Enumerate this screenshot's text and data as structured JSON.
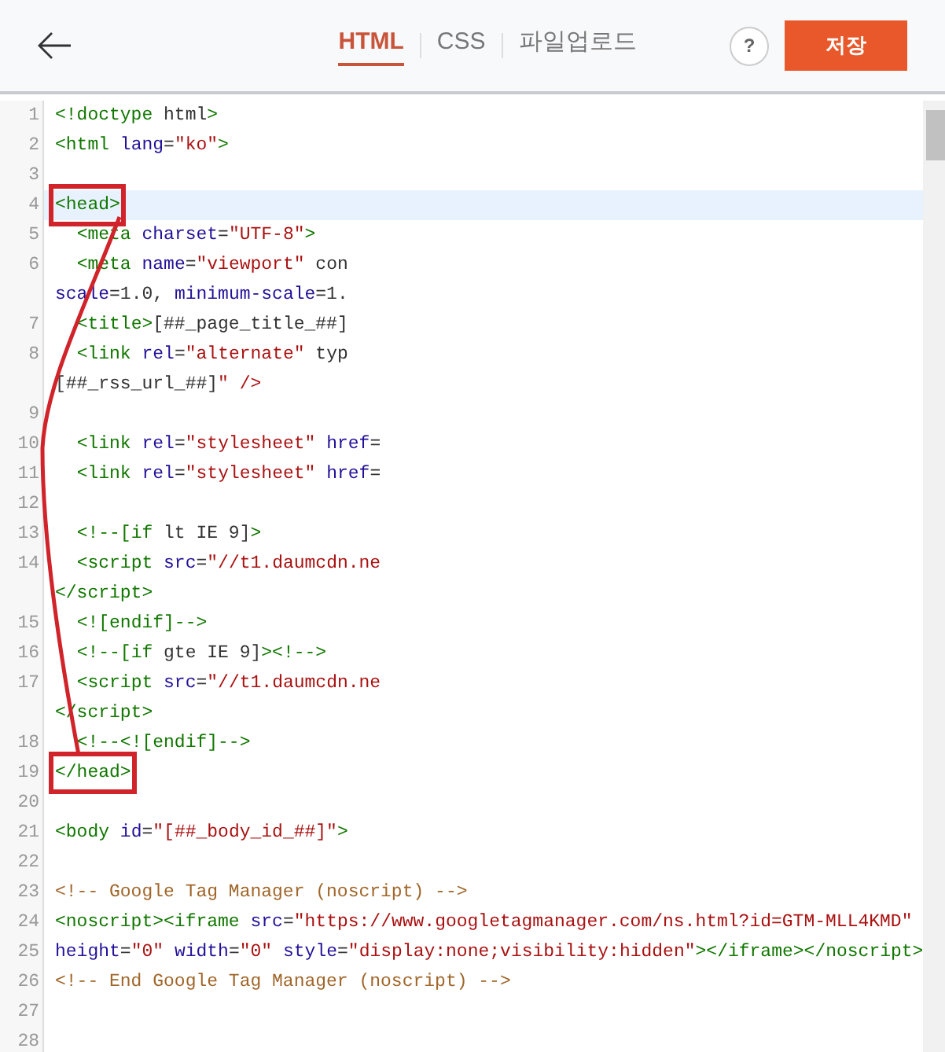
{
  "tabs": [
    {
      "label": "HTML",
      "selected": true
    },
    {
      "label": "CSS",
      "selected": false
    },
    {
      "label": "파일업로드",
      "selected": false
    }
  ],
  "help": {
    "label": "?"
  },
  "save_button": {
    "label": "저장"
  },
  "editor": {
    "lines": [
      {
        "number": "1",
        "text": "<!doctype html>",
        "active": false,
        "marked": false
      },
      {
        "number": "2",
        "text": "<html lang=\"ko\">",
        "active": false,
        "marked": false
      },
      {
        "number": "3",
        "active": false,
        "marked": false
      },
      {
        "number": "4",
        "text": "<head>",
        "active": true,
        "marked": true
      },
      {
        "number": "5",
        "text": "  <meta charset=\"UTF-8\">",
        "active": false,
        "marked": false
      },
      {
        "number": "6",
        "text": "  <meta name=\"viewport\" con",
        "active": false,
        "marked": false,
        "continuation": "scale=1.0, minimum-scale=1."
      },
      {
        "number": "7",
        "text": "  <title>[##_page_title_##]",
        "active": false,
        "marked": false
      },
      {
        "number": "8",
        "text": "  <link rel=\"alternate\" typ",
        "active": false,
        "marked": false,
        "continuation": "[##_rss_url_##]\" />"
      },
      {
        "number": "9",
        "active": false,
        "marked": false
      },
      {
        "number": "10",
        "text": "  <link rel=\"stylesheet\" href=",
        "active": false,
        "marked": false
      },
      {
        "number": "11",
        "text": "  <link rel=\"stylesheet\" href=",
        "active": false,
        "marked": false
      },
      {
        "number": "12",
        "active": false,
        "marked": false
      },
      {
        "number": "13",
        "text": "  <!--[if lt IE 9]>",
        "active": false,
        "marked": false
      },
      {
        "number": "14",
        "text": "  <script src=\"//t1.daumcdn.ne",
        "active": false,
        "marked": false,
        "continuation": "</script>"
      },
      {
        "number": "15",
        "text": "  <![endif]-->",
        "active": false,
        "marked": false
      },
      {
        "number": "16",
        "text": "  <!--[if gte IE 9]><!-->",
        "active": false,
        "marked": false
      },
      {
        "number": "17",
        "text": "  <script src=\"//t1.daumcdn.ne",
        "active": false,
        "marked": false,
        "continuation": "</script>"
      },
      {
        "number": "18",
        "text": "  <!--<![endif]-->",
        "active": false,
        "marked": false
      },
      {
        "number": "19",
        "text": "</head>",
        "active": false,
        "marked": true
      },
      {
        "number": "20",
        "active": false,
        "marked": false
      },
      {
        "number": "21",
        "text": "<body id=\"[##_body_id_##]\">",
        "active": false,
        "marked": false
      },
      {
        "number": "22",
        "active": false,
        "marked": false
      },
      {
        "number": "23",
        "text": "<!-- Google Tag Manager (noscript) -->",
        "active": false,
        "marked": false
      },
      {
        "number": "24",
        "text": "<noscript><iframe src=\"https://www.googletagmanager.com/ns.html?id=GTM-MLL4KMD\"",
        "active": false,
        "marked": false
      },
      {
        "number": "25",
        "text": "height=\"0\" width=\"0\" style=\"display:none;visibility:hidden\"></iframe></noscript>",
        "active": false,
        "marked": false
      },
      {
        "number": "26",
        "text": "<!-- End Google Tag Manager (noscript) -->",
        "active": false,
        "marked": false
      },
      {
        "number": "27",
        "active": false,
        "marked": false
      },
      {
        "number": "28",
        "active": false,
        "marked": false
      }
    ]
  }
}
